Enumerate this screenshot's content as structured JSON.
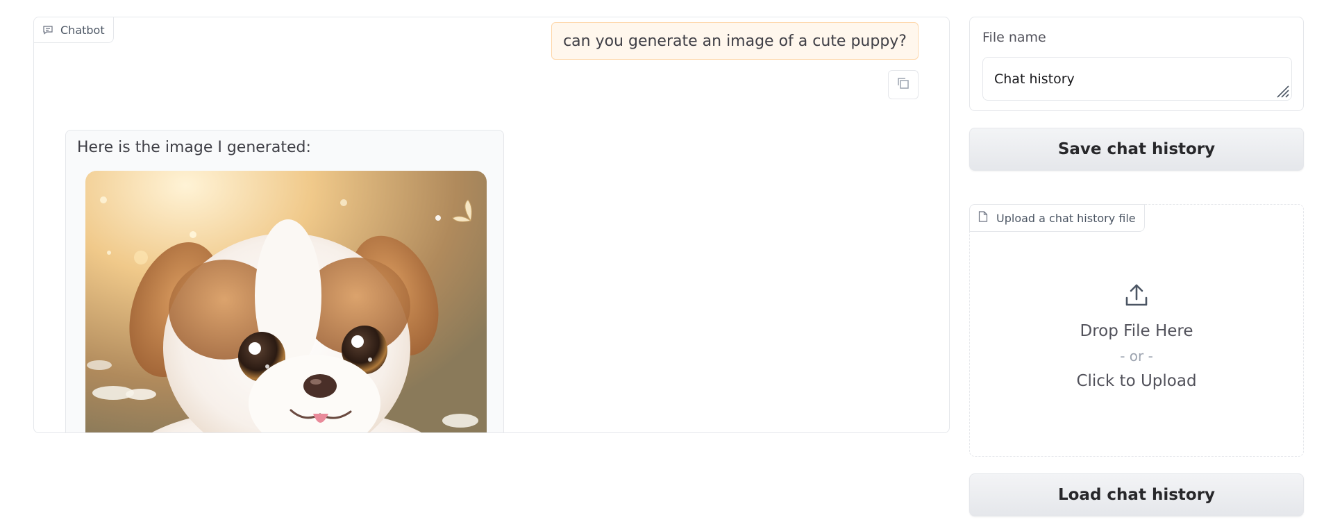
{
  "chatbot": {
    "label": "Chatbot",
    "user_message": "can you generate an image of a cute puppy?",
    "bot_message": "Here is the image I generated:",
    "image_alt": "cute puppy"
  },
  "file_name": {
    "label": "File name",
    "value": "Chat history"
  },
  "buttons": {
    "save": "Save chat history",
    "load": "Load chat history"
  },
  "upload": {
    "label": "Upload a chat history file",
    "drop": "Drop File Here",
    "or": "- or -",
    "click": "Click to Upload"
  },
  "colors": {
    "user_bubble_bg": "#fff7ed",
    "user_bubble_border": "#fed7aa",
    "bot_bubble_bg": "#f9fafb",
    "border": "#e5e7eb"
  }
}
